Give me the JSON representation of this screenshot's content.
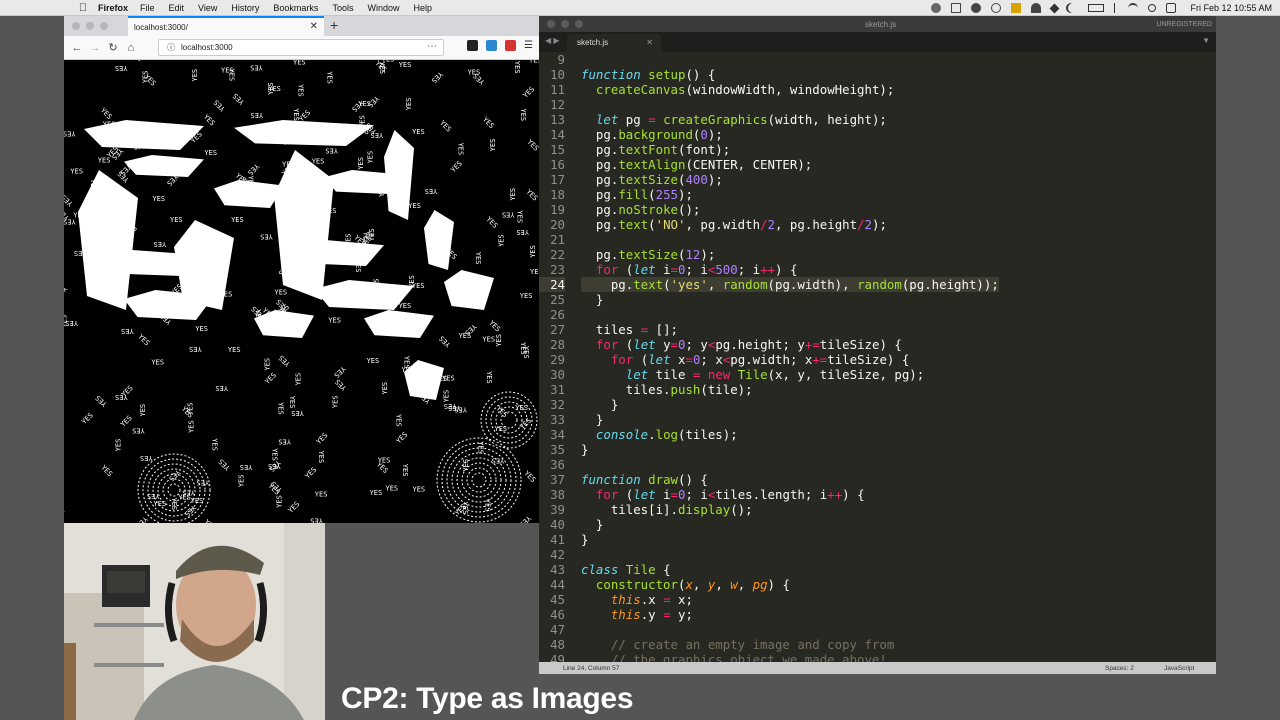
{
  "menubar": {
    "app": "Firefox",
    "items": [
      "File",
      "Edit",
      "View",
      "History",
      "Bookmarks",
      "Tools",
      "Window",
      "Help"
    ],
    "clock": "Fri Feb 12  10:55 AM"
  },
  "firefox": {
    "tab_title": "localhost:3000/",
    "url": "localhost:3000",
    "canvas_words": [
      "YES",
      "NO"
    ]
  },
  "sublime": {
    "window_title": "sketch.js",
    "unregistered": "UNREGISTERED",
    "tab_title": "sketch.js",
    "current_line": 24,
    "status": {
      "position": "Line 24, Column 57",
      "spaces": "Spaces: 2",
      "syntax": "JavaScript"
    },
    "lines": [
      {
        "n": 9,
        "t": [
          [
            "",
            ""
          ]
        ]
      },
      {
        "n": 10,
        "t": [
          [
            "kw",
            "function"
          ],
          [
            "",
            " "
          ],
          [
            "fn",
            "setup"
          ],
          [
            "",
            "() {"
          ]
        ]
      },
      {
        "n": 11,
        "t": [
          [
            "",
            "  "
          ],
          [
            "fn",
            "createCanvas"
          ],
          [
            "",
            "(windowWidth, windowHeight);"
          ]
        ]
      },
      {
        "n": 12,
        "t": [
          [
            "",
            ""
          ]
        ]
      },
      {
        "n": 13,
        "t": [
          [
            "",
            "  "
          ],
          [
            "kw",
            "let"
          ],
          [
            "",
            " pg "
          ],
          [
            "op",
            "="
          ],
          [
            "",
            " "
          ],
          [
            "fn",
            "createGraphics"
          ],
          [
            "",
            "(width, height);"
          ]
        ]
      },
      {
        "n": 14,
        "t": [
          [
            "",
            "  pg."
          ],
          [
            "fn",
            "background"
          ],
          [
            "",
            "("
          ],
          [
            "nm",
            "0"
          ],
          [
            "",
            ");"
          ]
        ]
      },
      {
        "n": 15,
        "t": [
          [
            "",
            "  pg."
          ],
          [
            "fn",
            "textFont"
          ],
          [
            "",
            "(font);"
          ]
        ]
      },
      {
        "n": 16,
        "t": [
          [
            "",
            "  pg."
          ],
          [
            "fn",
            "textAlign"
          ],
          [
            "",
            "(CENTER, CENTER);"
          ]
        ]
      },
      {
        "n": 17,
        "t": [
          [
            "",
            "  pg."
          ],
          [
            "fn",
            "textSize"
          ],
          [
            "",
            "("
          ],
          [
            "nm",
            "400"
          ],
          [
            "",
            ");"
          ]
        ]
      },
      {
        "n": 18,
        "t": [
          [
            "",
            "  pg."
          ],
          [
            "fn",
            "fill"
          ],
          [
            "",
            "("
          ],
          [
            "nm",
            "255"
          ],
          [
            "",
            ");"
          ]
        ]
      },
      {
        "n": 19,
        "t": [
          [
            "",
            "  pg."
          ],
          [
            "fn",
            "noStroke"
          ],
          [
            "",
            "();"
          ]
        ]
      },
      {
        "n": 20,
        "t": [
          [
            "",
            "  pg."
          ],
          [
            "fn",
            "text"
          ],
          [
            "",
            "("
          ],
          [
            "st",
            "'NO'"
          ],
          [
            "",
            ", pg.width"
          ],
          [
            "op",
            "/"
          ],
          [
            "nm",
            "2"
          ],
          [
            "",
            ", pg.height"
          ],
          [
            "op",
            "/"
          ],
          [
            "nm",
            "2"
          ],
          [
            "",
            ");"
          ]
        ]
      },
      {
        "n": 21,
        "t": [
          [
            "",
            ""
          ]
        ]
      },
      {
        "n": 22,
        "t": [
          [
            "",
            "  pg."
          ],
          [
            "fn",
            "textSize"
          ],
          [
            "",
            "("
          ],
          [
            "nm",
            "12"
          ],
          [
            "",
            ");"
          ]
        ]
      },
      {
        "n": 23,
        "t": [
          [
            "",
            "  "
          ],
          [
            "op",
            "for"
          ],
          [
            "",
            " ("
          ],
          [
            "kw",
            "let"
          ],
          [
            "",
            " i"
          ],
          [
            "op",
            "="
          ],
          [
            "nm",
            "0"
          ],
          [
            "",
            "; i"
          ],
          [
            "op",
            "<"
          ],
          [
            "nm",
            "500"
          ],
          [
            "",
            "; i"
          ],
          [
            "op",
            "++"
          ],
          [
            "",
            ") {"
          ]
        ]
      },
      {
        "n": 24,
        "t": [
          [
            "",
            "    pg."
          ],
          [
            "fn",
            "text"
          ],
          [
            "",
            "("
          ],
          [
            "st",
            "'yes'"
          ],
          [
            "",
            ", "
          ],
          [
            "fn",
            "random"
          ],
          [
            "",
            "(pg.width), "
          ],
          [
            "fn",
            "random"
          ],
          [
            "",
            "(pg.height));"
          ]
        ]
      },
      {
        "n": 25,
        "t": [
          [
            "",
            "  }"
          ]
        ]
      },
      {
        "n": 26,
        "t": [
          [
            "",
            ""
          ]
        ]
      },
      {
        "n": 27,
        "t": [
          [
            "",
            "  tiles "
          ],
          [
            "op",
            "="
          ],
          [
            "",
            " [];"
          ]
        ]
      },
      {
        "n": 28,
        "t": [
          [
            "",
            "  "
          ],
          [
            "op",
            "for"
          ],
          [
            "",
            " ("
          ],
          [
            "kw",
            "let"
          ],
          [
            "",
            " y"
          ],
          [
            "op",
            "="
          ],
          [
            "nm",
            "0"
          ],
          [
            "",
            "; y"
          ],
          [
            "op",
            "<"
          ],
          [
            "",
            "pg.height; y"
          ],
          [
            "op",
            "+="
          ],
          [
            "",
            "tileSize) {"
          ]
        ]
      },
      {
        "n": 29,
        "t": [
          [
            "",
            "    "
          ],
          [
            "op",
            "for"
          ],
          [
            "",
            " ("
          ],
          [
            "kw",
            "let"
          ],
          [
            "",
            " x"
          ],
          [
            "op",
            "="
          ],
          [
            "nm",
            "0"
          ],
          [
            "",
            "; x"
          ],
          [
            "op",
            "<"
          ],
          [
            "",
            "pg.width; x"
          ],
          [
            "op",
            "+="
          ],
          [
            "",
            "tileSize) {"
          ]
        ]
      },
      {
        "n": 30,
        "t": [
          [
            "",
            "      "
          ],
          [
            "kw",
            "let"
          ],
          [
            "",
            " tile "
          ],
          [
            "op",
            "="
          ],
          [
            "",
            " "
          ],
          [
            "op",
            "new"
          ],
          [
            "",
            " "
          ],
          [
            "fn",
            "Tile"
          ],
          [
            "",
            "(x, y, tileSize, pg);"
          ]
        ]
      },
      {
        "n": 31,
        "t": [
          [
            "",
            "      tiles."
          ],
          [
            "fn",
            "push"
          ],
          [
            "",
            "(tile);"
          ]
        ]
      },
      {
        "n": 32,
        "t": [
          [
            "",
            "    }"
          ]
        ]
      },
      {
        "n": 33,
        "t": [
          [
            "",
            "  }"
          ]
        ]
      },
      {
        "n": 34,
        "t": [
          [
            "",
            "  "
          ],
          [
            "kw",
            "console"
          ],
          [
            "",
            "."
          ],
          [
            "fn",
            "log"
          ],
          [
            "",
            "(tiles);"
          ]
        ]
      },
      {
        "n": 35,
        "t": [
          [
            "",
            "}"
          ]
        ]
      },
      {
        "n": 36,
        "t": [
          [
            "",
            ""
          ]
        ]
      },
      {
        "n": 37,
        "t": [
          [
            "kw",
            "function"
          ],
          [
            "",
            " "
          ],
          [
            "fn",
            "draw"
          ],
          [
            "",
            "() {"
          ]
        ]
      },
      {
        "n": 38,
        "t": [
          [
            "",
            "  "
          ],
          [
            "op",
            "for"
          ],
          [
            "",
            " ("
          ],
          [
            "kw",
            "let"
          ],
          [
            "",
            " i"
          ],
          [
            "op",
            "="
          ],
          [
            "nm",
            "0"
          ],
          [
            "",
            "; i"
          ],
          [
            "op",
            "<"
          ],
          [
            "",
            "tiles.length; i"
          ],
          [
            "op",
            "++"
          ],
          [
            "",
            ") {"
          ]
        ]
      },
      {
        "n": 39,
        "t": [
          [
            "",
            "    tiles[i]."
          ],
          [
            "fn",
            "display"
          ],
          [
            "",
            "();"
          ]
        ]
      },
      {
        "n": 40,
        "t": [
          [
            "",
            "  }"
          ]
        ]
      },
      {
        "n": 41,
        "t": [
          [
            "",
            "}"
          ]
        ]
      },
      {
        "n": 42,
        "t": [
          [
            "",
            ""
          ]
        ]
      },
      {
        "n": 43,
        "t": [
          [
            "kw",
            "class"
          ],
          [
            "",
            " "
          ],
          [
            "fn",
            "Tile"
          ],
          [
            "",
            " {"
          ]
        ]
      },
      {
        "n": 44,
        "t": [
          [
            "",
            "  "
          ],
          [
            "fn",
            "constructor"
          ],
          [
            "",
            "("
          ],
          [
            "pa",
            "x"
          ],
          [
            "",
            ", "
          ],
          [
            "pa",
            "y"
          ],
          [
            "",
            ", "
          ],
          [
            "pa",
            "w"
          ],
          [
            "",
            ", "
          ],
          [
            "pa",
            "pg"
          ],
          [
            "",
            ") {"
          ]
        ]
      },
      {
        "n": 45,
        "t": [
          [
            "",
            "    "
          ],
          [
            "th",
            "this"
          ],
          [
            "",
            ".x "
          ],
          [
            "op",
            "="
          ],
          [
            "",
            " x;"
          ]
        ]
      },
      {
        "n": 46,
        "t": [
          [
            "",
            "    "
          ],
          [
            "th",
            "this"
          ],
          [
            "",
            ".y "
          ],
          [
            "op",
            "="
          ],
          [
            "",
            " y;"
          ]
        ]
      },
      {
        "n": 47,
        "t": [
          [
            "",
            ""
          ]
        ]
      },
      {
        "n": 48,
        "t": [
          [
            "",
            "    "
          ],
          [
            "cm",
            "// create an empty image and copy from"
          ]
        ]
      },
      {
        "n": 49,
        "t": [
          [
            "",
            "    "
          ],
          [
            "cm",
            "// the graphics object we made above!"
          ]
        ]
      }
    ]
  },
  "caption": "CP2: Type as Images",
  "colors": {
    "editor_bg": "#272822",
    "keyword": "#66d9ef",
    "function": "#a6e22e",
    "number": "#ae81ff",
    "operator": "#f92672",
    "string": "#e6db74"
  }
}
